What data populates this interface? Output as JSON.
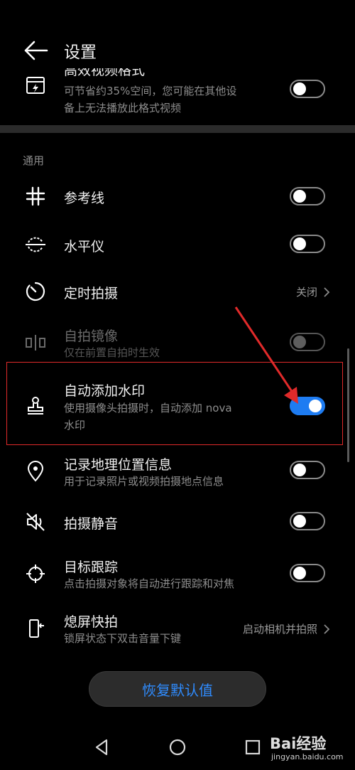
{
  "header": {
    "title": "设置"
  },
  "partial_item": {
    "title": "高效视频格式",
    "desc_line1": "可节省约35%空间，您可能在其他设",
    "desc_line2": "备上无法播放此格式视频",
    "toggle": false
  },
  "section": {
    "title": "通用"
  },
  "items": [
    {
      "title": "参考线",
      "icon": "grid-icon",
      "toggle": false
    },
    {
      "title": "水平仪",
      "icon": "level-icon",
      "toggle": false
    },
    {
      "title": "定时拍摄",
      "icon": "timer-icon",
      "value": "关闭"
    },
    {
      "title": "自拍镜像",
      "desc": "仅在前置自拍时生效",
      "icon": "mirror-icon",
      "toggle": false,
      "disabled": true
    },
    {
      "title": "自动添加水印",
      "desc_line1": "使用摄像头拍摄时，自动添加 nova",
      "desc_line2": "水印",
      "icon": "stamp-icon",
      "toggle": true
    },
    {
      "title": "记录地理位置信息",
      "desc": "用于记录照片或视频拍摄地点信息",
      "icon": "location-icon",
      "toggle": false
    },
    {
      "title": "拍摄静音",
      "icon": "mute-icon",
      "toggle": false
    },
    {
      "title": "目标跟踪",
      "desc": "点击拍摄对象将自动进行跟踪和对焦",
      "icon": "target-icon",
      "toggle": false
    },
    {
      "title": "熄屏快拍",
      "desc": "锁屏状态下双击音量下键",
      "icon": "quick-snap-icon",
      "value": "启动相机并拍照"
    }
  ],
  "reset_button": {
    "label": "恢复默认值"
  },
  "accent_color": "#1e7cf2",
  "annotation_color": "#e02a2a",
  "watermark": {
    "logo": "Bai经验",
    "url": "jingyan.baidu.com"
  }
}
